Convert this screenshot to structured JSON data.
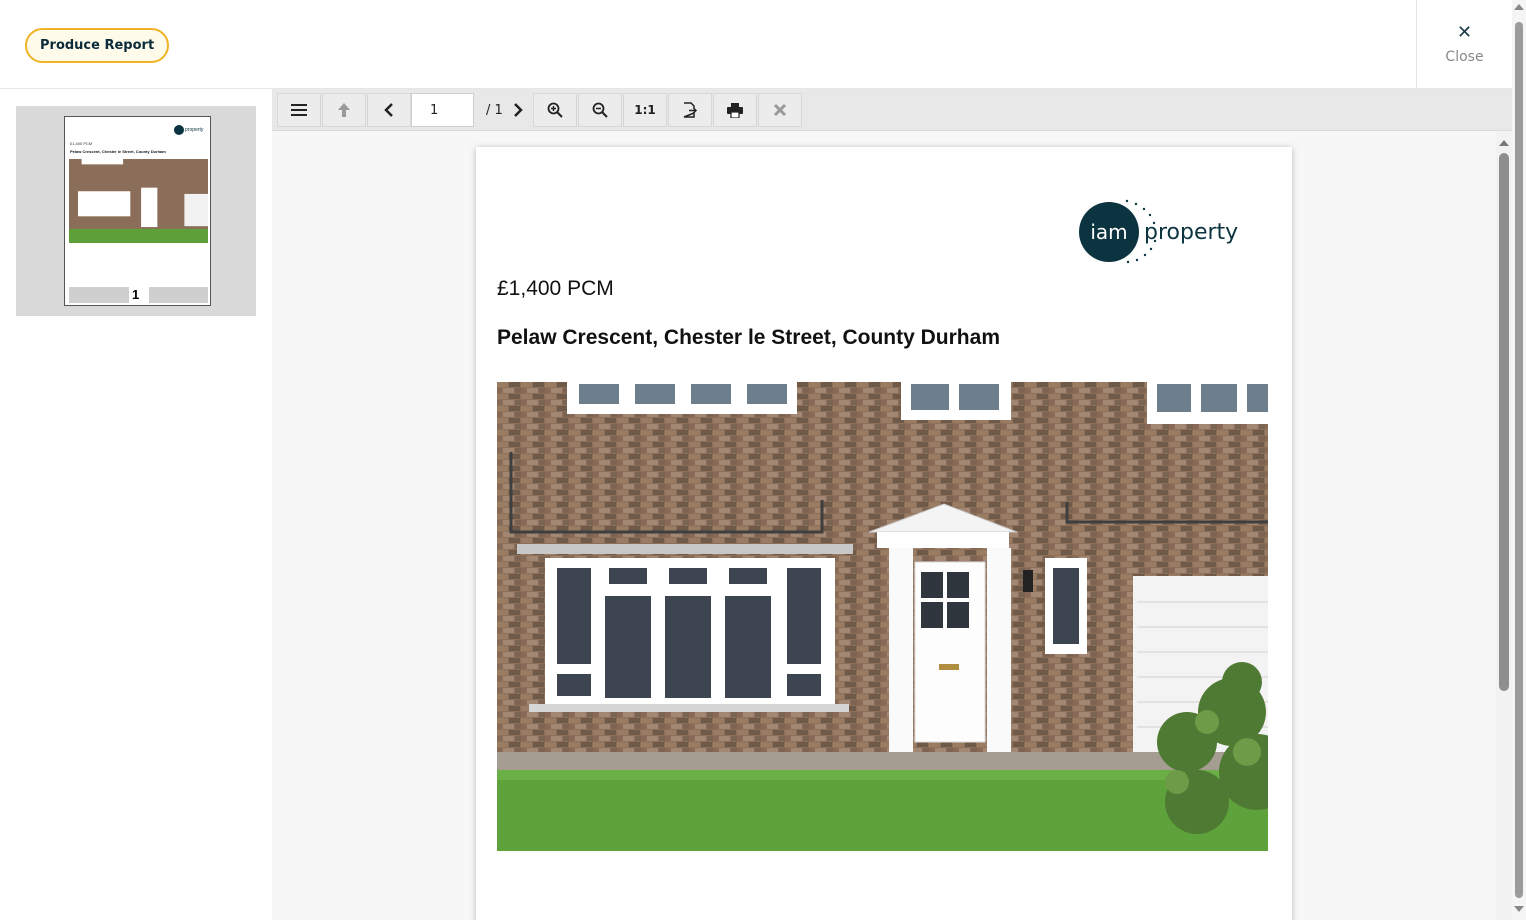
{
  "header": {
    "produce_report_label": "Produce Report",
    "close_label": "Close",
    "close_glyph": "✕"
  },
  "sidebar": {
    "thumbnail": {
      "price": "£1,400 PCM",
      "address": "Pelaw Crescent, Chester le Street, County Durham",
      "page_number": "1",
      "logo_text": "property"
    }
  },
  "viewer": {
    "toolbar": {
      "menu_icon": "hamburger-menu-icon",
      "up_icon": "arrow-up-icon",
      "prev_icon": "chevron-left-icon",
      "current_page": "1",
      "total_pages": "/ 1",
      "next_icon": "chevron-right-icon",
      "zoom_in_icon": "zoom-in-icon",
      "zoom_out_icon": "zoom-out-icon",
      "actual_size_label": "1:1",
      "export_icon": "export-icon",
      "print_icon": "print-icon",
      "close_icon": "close-x-icon"
    },
    "document": {
      "logo_iam": "iam",
      "logo_property": "property",
      "price": "£1,400 PCM",
      "address": "Pelaw Crescent, Chester le Street, County Durham"
    }
  },
  "colors": {
    "accent": "#f0b323",
    "brand": "#0c3440",
    "toolbar_bg": "#e8e8e8",
    "thumb_bg": "#d9d9d9"
  }
}
